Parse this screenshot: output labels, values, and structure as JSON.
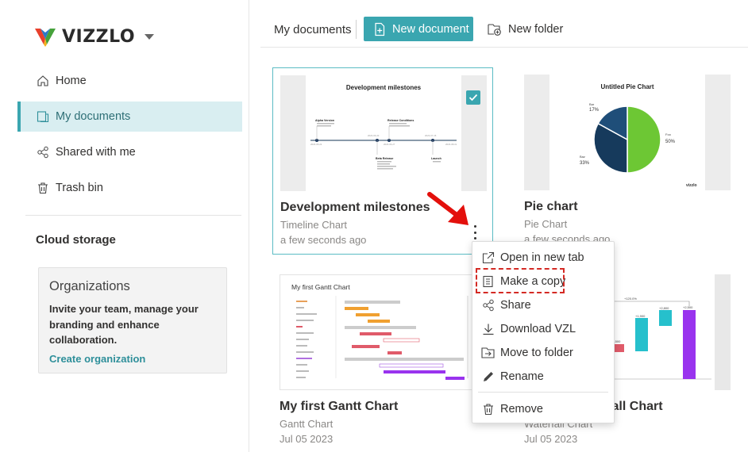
{
  "brand": {
    "name": "VIZZLO"
  },
  "sidebar": {
    "items": [
      {
        "label": "Home",
        "icon": "home-icon"
      },
      {
        "label": "My documents",
        "icon": "documents-icon",
        "active": true
      },
      {
        "label": "Shared with me",
        "icon": "share-icon"
      },
      {
        "label": "Trash bin",
        "icon": "trash-icon"
      }
    ],
    "cloud_storage": "Cloud storage",
    "org_card": {
      "title": "Organizations",
      "text": "Invite your team, manage your branding and enhance collaboration.",
      "link": "Create organization"
    }
  },
  "toolbar": {
    "breadcrumb": "My documents",
    "new_document": "New document",
    "new_folder": "New folder"
  },
  "documents": [
    {
      "title": "Development milestones",
      "type": "Timeline Chart",
      "date": "a few seconds ago",
      "selected": true,
      "thumb": {
        "heading": "Development milestones",
        "events": [
          "Alpha Version",
          "Release Conditions",
          "Beta Release",
          "Launch"
        ],
        "ticks": [
          "2023-05-22",
          "2023-06-20",
          "2023-06-27",
          "2023-07-15",
          "2023-08-01"
        ]
      }
    },
    {
      "title": "Pie chart",
      "type": "Pie Chart",
      "date": "a few seconds ago",
      "thumb": {
        "heading": "Untitled Pie Chart",
        "slices": [
          {
            "label": "Bar",
            "pct": "17%",
            "value": 17,
            "color": "#1f4e79"
          },
          {
            "label": "Foo",
            "pct": "50%",
            "value": 50,
            "color": "#6dc734"
          },
          {
            "label": "Baz",
            "pct": "33%",
            "value": 33,
            "color": "#163a5c"
          }
        ],
        "watermark": "vizzlo"
      }
    },
    {
      "title": "My first Gantt Chart",
      "type": "Gantt Chart",
      "date": "Jul 05 2023",
      "thumb": {
        "heading": "My first Gantt Chart"
      }
    },
    {
      "title": "My first Waterfall Chart",
      "type": "Waterfall Chart",
      "date": "Jul 05 2023",
      "thumb": {
        "labels": [
          "+120.0%",
          "+2,800",
          "+1,900",
          "-1,000",
          "-1,500",
          "+2,500"
        ]
      }
    }
  ],
  "context_menu": {
    "items": [
      {
        "label": "Open in new tab",
        "icon": "external-link-icon"
      },
      {
        "label": "Make a copy",
        "icon": "copy-icon",
        "highlighted": true
      },
      {
        "label": "Share",
        "icon": "share-icon"
      },
      {
        "label": "Download VZL",
        "icon": "download-icon"
      },
      {
        "label": "Move to folder",
        "icon": "move-folder-icon"
      },
      {
        "label": "Rename",
        "icon": "pencil-icon"
      },
      {
        "label": "Remove",
        "icon": "trash-icon"
      }
    ]
  },
  "colors": {
    "accent": "#3aa6b0",
    "highlight": "#d42a24",
    "active_bg": "#d9eef1"
  }
}
